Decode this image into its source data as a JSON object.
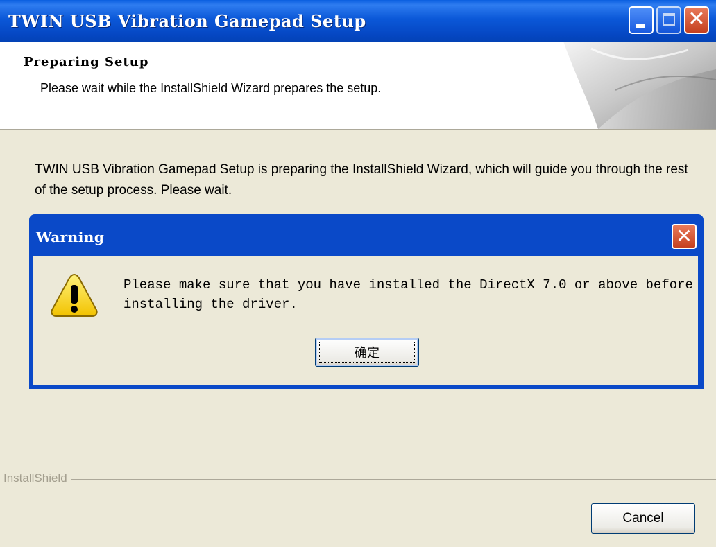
{
  "window": {
    "title": "TWIN USB Vibration Gamepad Setup",
    "title_bar_color": "#0A5FE0"
  },
  "header": {
    "title": "Preparing Setup",
    "subtitle": "Please wait while the InstallShield Wizard prepares the setup."
  },
  "body": {
    "message": "TWIN USB Vibration Gamepad Setup is preparing the InstallShield Wizard, which will guide you through the rest of the setup process. Please wait."
  },
  "dialog": {
    "title": "Warning",
    "icon": "warning-icon",
    "message": "Please make sure that you have installed the DirectX 7.0 or above before installing the driver.",
    "ok_label": "确定"
  },
  "footer": {
    "brand": "InstallShield",
    "cancel_label": "Cancel"
  },
  "colors": {
    "face": "#ECE9D8",
    "dialog_frame": "#0A49C8",
    "close_button": "#C5401F"
  }
}
